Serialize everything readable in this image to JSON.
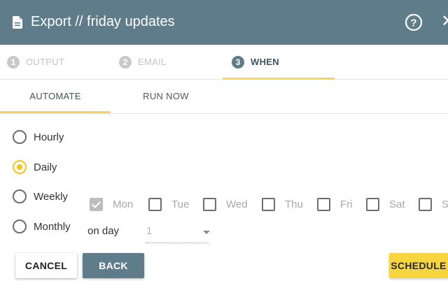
{
  "header": {
    "title": "Export // friday updates",
    "icons": [
      "document-icon",
      "help-icon",
      "close-icon"
    ],
    "color": "#5f7c8a"
  },
  "steps": [
    {
      "number": "1",
      "label": "OUTPUT",
      "active": false
    },
    {
      "number": "2",
      "label": "EMAIL",
      "active": false
    },
    {
      "number": "3",
      "label": "WHEN",
      "active": true
    }
  ],
  "tabs": [
    {
      "label": "AUTOMATE",
      "active": true
    },
    {
      "label": "RUN NOW",
      "active": false
    }
  ],
  "frequency": {
    "options": [
      {
        "label": "Hourly",
        "checked": false
      },
      {
        "label": "Daily",
        "checked": true
      },
      {
        "label": "Weekly",
        "checked": false
      },
      {
        "label": "Monthly",
        "checked": false
      }
    ]
  },
  "weekdays": [
    {
      "label": "Mon",
      "checked": true
    },
    {
      "label": "Tue",
      "checked": false
    },
    {
      "label": "Wed",
      "checked": false
    },
    {
      "label": "Thu",
      "checked": false
    },
    {
      "label": "Fri",
      "checked": false
    },
    {
      "label": "Sat",
      "checked": false
    },
    {
      "label": "Sun",
      "checked": false
    }
  ],
  "monthly": {
    "on_day_label": "on day",
    "day_value": "1"
  },
  "buttons": {
    "cancel": "CANCEL",
    "back": "BACK",
    "schedule": "SCHEDULE"
  },
  "colors": {
    "accent": "#f5d55a",
    "primary": "#5f7c8a"
  }
}
